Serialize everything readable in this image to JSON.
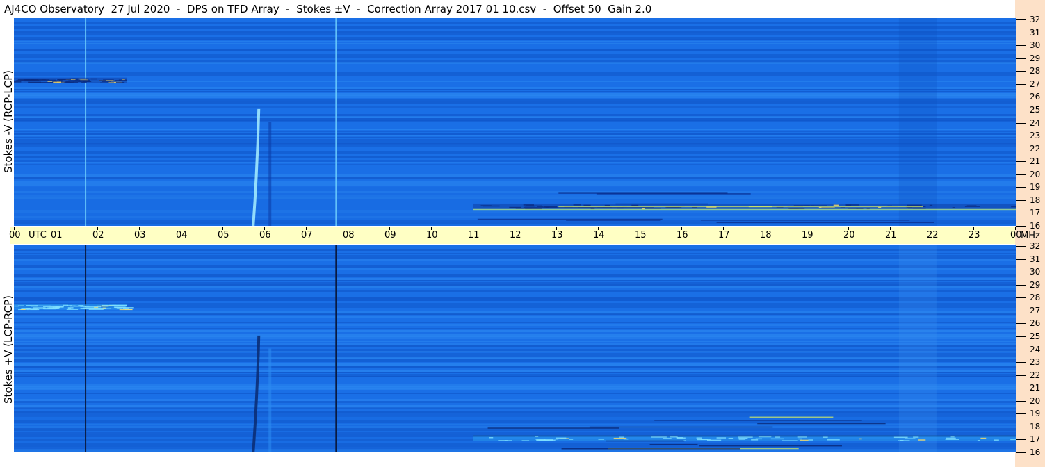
{
  "header": {
    "title": "AJ4CO Observatory  27 Jul 2020  -  DPS on TFD Array  -  Stokes ±V  -  Correction Array 2017 01 10.csv  -  Offset 50  Gain 2.0"
  },
  "panels": [
    {
      "label": "Stokes -V (RCP-LCP)"
    },
    {
      "label": "Stokes +V (LCP-RCP)"
    }
  ],
  "time_axis": {
    "unit": "UTC",
    "labels": [
      "00",
      "01",
      "02",
      "03",
      "04",
      "05",
      "06",
      "07",
      "08",
      "09",
      "10",
      "11",
      "12",
      "13",
      "14",
      "15",
      "16",
      "17",
      "18",
      "19",
      "20",
      "21",
      "22",
      "23",
      "00"
    ]
  },
  "freq_axis": {
    "unit": "MHz",
    "labels": [
      "32",
      "31",
      "30",
      "29",
      "28",
      "27",
      "26",
      "25",
      "24",
      "23",
      "22",
      "21",
      "20",
      "19",
      "18",
      "17",
      "16"
    ]
  },
  "colors": {
    "background": "#1a6fe6",
    "band_dark": "#0f55c8",
    "band_light": "#2a86f0",
    "timebar": "#ffffc4",
    "side": "#fde1c8"
  },
  "chart_data": {
    "type": "heatmap",
    "title": "AJ4CO Observatory  27 Jul 2020  -  DPS on TFD Array  -  Stokes ±V  -  Correction Array 2017 01 10.csv  -  Offset 50  Gain 2.0",
    "xlabel": "UTC",
    "ylabel": "MHz",
    "x_range": [
      0,
      24
    ],
    "y_range": [
      16,
      32
    ],
    "series": [
      {
        "name": "Stokes -V (RCP-LCP)",
        "features": [
          {
            "kind": "vertical_line",
            "utc": 1.7,
            "style": "light"
          },
          {
            "kind": "vertical_line",
            "utc": 7.7,
            "style": "light"
          },
          {
            "kind": "burst",
            "utc_start": 5.7,
            "utc_end": 5.9,
            "mhz_low": 16,
            "mhz_high": 25
          },
          {
            "kind": "rfi_band",
            "mhz": 27.2,
            "utc_start": 0,
            "utc_end": 2.7
          },
          {
            "kind": "rfi_band",
            "mhz": 17.5,
            "utc_start": 11,
            "utc_end": 24
          }
        ]
      },
      {
        "name": "Stokes +V (LCP-RCP)",
        "features": [
          {
            "kind": "vertical_line",
            "utc": 1.7,
            "style": "dark"
          },
          {
            "kind": "vertical_line",
            "utc": 7.7,
            "style": "dark"
          },
          {
            "kind": "burst",
            "utc_start": 5.7,
            "utc_end": 5.9,
            "mhz_low": 16,
            "mhz_high": 25
          },
          {
            "kind": "rfi_band",
            "mhz": 27.2,
            "utc_start": 0,
            "utc_end": 2.7
          },
          {
            "kind": "rfi_band",
            "mhz": 17.1,
            "utc_start": 11,
            "utc_end": 24
          }
        ]
      }
    ]
  }
}
